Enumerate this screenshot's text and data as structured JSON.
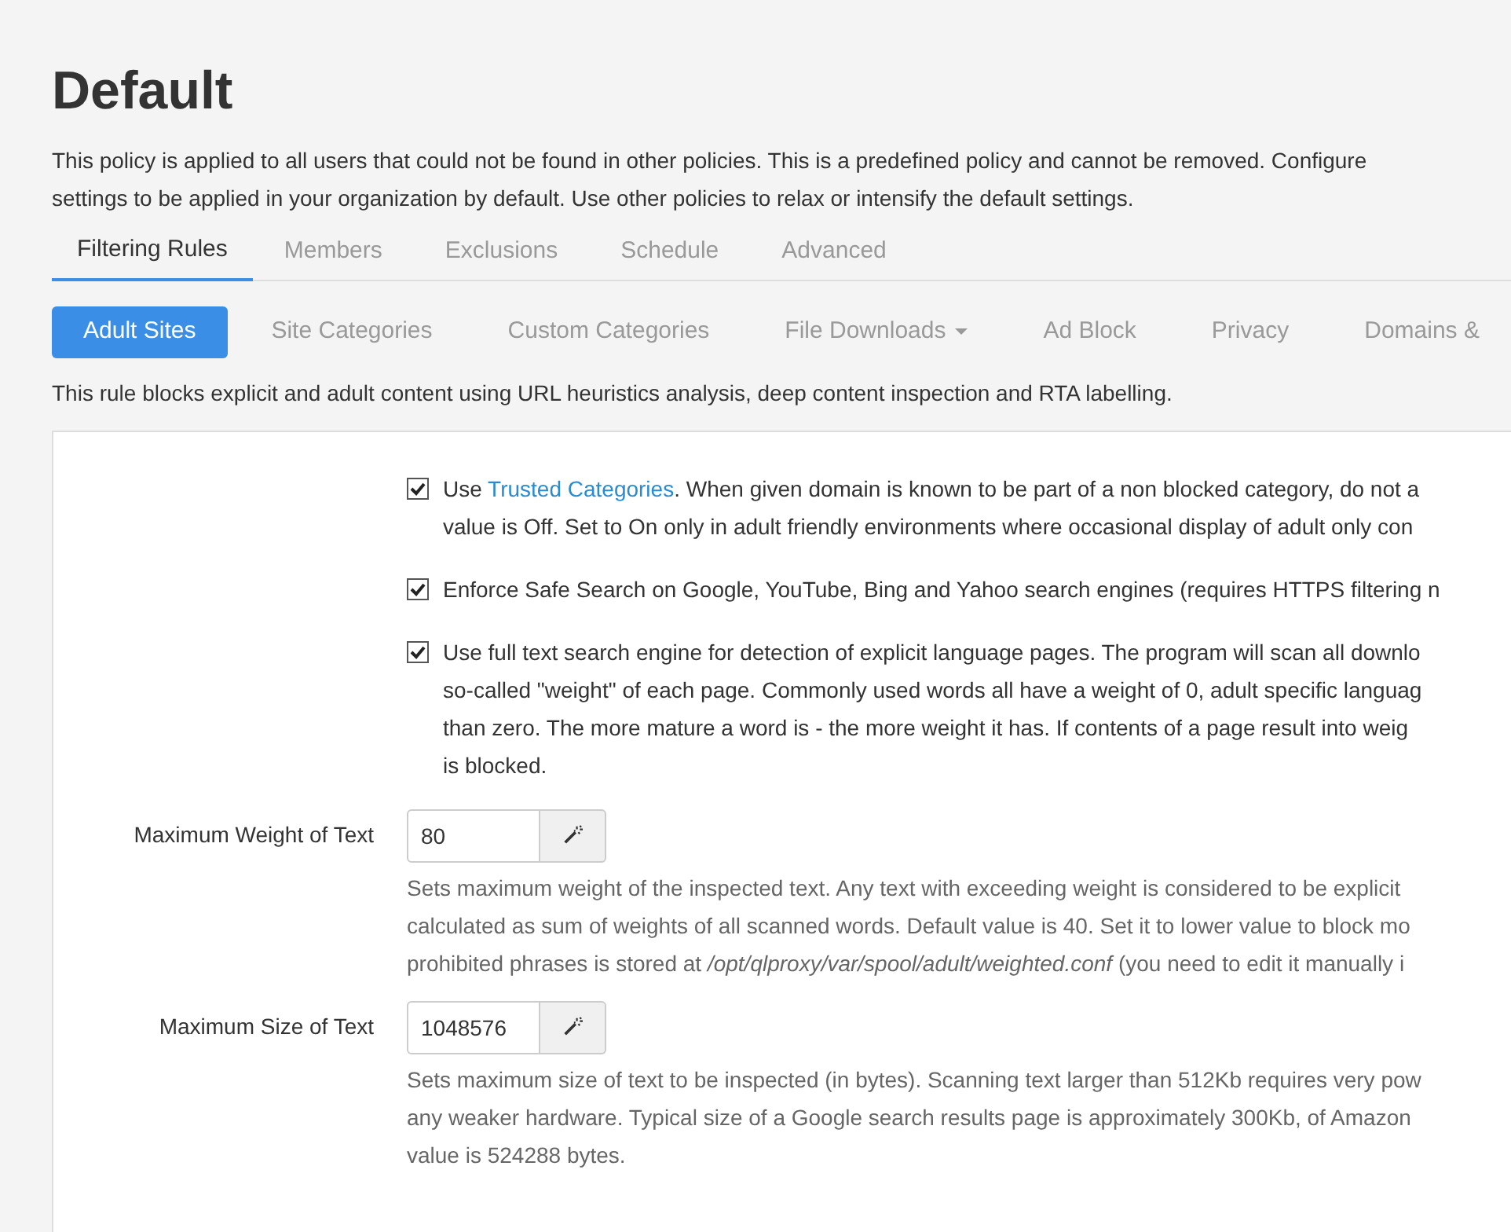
{
  "title": "Default",
  "description": [
    "This policy is applied to all users that could not be found in other policies. This is a predefined policy and cannot be removed. Configure",
    "settings to be applied in your organization by default. Use other policies to relax or intensify the default settings."
  ],
  "tabs": [
    {
      "label": "Filtering Rules",
      "selected": true
    },
    {
      "label": "Members",
      "selected": false
    },
    {
      "label": "Exclusions",
      "selected": false
    },
    {
      "label": "Schedule",
      "selected": false
    },
    {
      "label": "Advanced",
      "selected": false
    }
  ],
  "subtabs": [
    {
      "label": "Adult Sites",
      "selected": true
    },
    {
      "label": "Site Categories",
      "selected": false
    },
    {
      "label": "Custom Categories",
      "selected": false
    },
    {
      "label": "File Downloads",
      "selected": false,
      "dropdown": true
    },
    {
      "label": "Ad Block",
      "selected": false
    },
    {
      "label": "Privacy",
      "selected": false
    },
    {
      "label": "Domains &",
      "selected": false
    }
  ],
  "rule_description": "This rule blocks explicit and adult content using URL heuristics analysis, deep content inspection and RTA labelling.",
  "options": [
    {
      "checked": true,
      "before": "Use ",
      "link": "Trusted Categories",
      "lines": [
        ". When given domain is known to be part of a non blocked category, do not a",
        "value is Off. Set to On only in adult friendly environments where occasional display of adult only con"
      ]
    },
    {
      "checked": true,
      "lines": [
        "Enforce Safe Search on Google, YouTube, Bing and Yahoo search engines (requires HTTPS filtering n"
      ]
    },
    {
      "checked": true,
      "lines": [
        "Use full text search engine for detection of explicit language pages. The program will scan all downlo",
        "so-called \"weight\" of each page. Commonly used words all have a weight of 0, adult specific languag",
        "than zero. The more mature a word is - the more weight it has. If contents of a page result into weig",
        "is blocked."
      ]
    }
  ],
  "fields": [
    {
      "label": "Maximum Weight of Text",
      "value": "80",
      "help": [
        "Sets maximum weight of the inspected text. Any text with exceeding weight is considered to be explicit",
        "calculated as sum of weights of all scanned words. Default value is 40. Set it to lower value to block mo",
        "prohibited phrases is stored at */opt/qlproxy/var/spool/adult/weighted.conf* (you need to edit it manually i"
      ]
    },
    {
      "label": "Maximum Size of Text",
      "value": "1048576",
      "help": [
        "Sets maximum size of text to be inspected (in bytes). Scanning text larger than 512Kb requires very pow",
        "any weaker hardware. Typical size of a Google search results page is approximately 300Kb, of Amazon",
        "value is 524288 bytes."
      ]
    }
  ]
}
